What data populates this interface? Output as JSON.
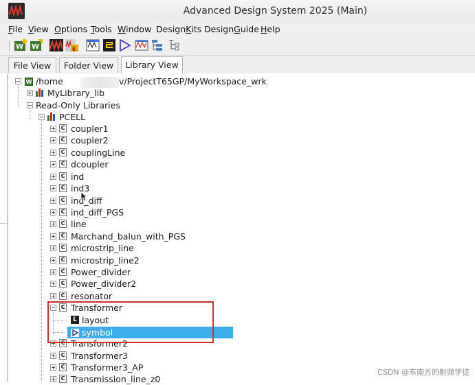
{
  "window": {
    "title": "Advanced Design System 2025 (Main)"
  },
  "menu": {
    "items": [
      {
        "label": "File",
        "mnemonic": "F",
        "rest": "ile"
      },
      {
        "label": "View",
        "mnemonic": "V",
        "rest": "iew"
      },
      {
        "label": "Options",
        "mnemonic": "O",
        "rest": "ptions"
      },
      {
        "label": "Tools",
        "mnemonic": "T",
        "rest": "ools"
      },
      {
        "label": "Window",
        "mnemonic": "W",
        "rest": "indow"
      },
      {
        "label": "DesignKits",
        "pre": "Design",
        "mnemonic": "K",
        "rest": "its"
      },
      {
        "label": "DesignGuide",
        "pre": "Design",
        "mnemonic": "G",
        "rest": "uide"
      },
      {
        "label": "Help",
        "mnemonic": "H",
        "rest": "elp"
      }
    ]
  },
  "toolbar": {
    "icons": [
      "new-workspace-icon",
      "open-workspace-icon",
      "ads-main-icon",
      "ads-extension-icon",
      "data-display-icon",
      "layout-icon",
      "schematic-symbol-icon",
      "simulation-icon",
      "hierarchy-icon",
      "tree-icon"
    ]
  },
  "tabs": [
    {
      "label": "File View",
      "active": false
    },
    {
      "label": "Folder View",
      "active": false
    },
    {
      "label": "Library View",
      "active": true
    }
  ],
  "tree": {
    "workspace_path_prefix": "/home",
    "workspace_path_suffix": "v/ProjectT65GP/MyWorkspace_wrk",
    "my_library": "MyLibrary_lib",
    "read_only_group": "Read-Only Libraries",
    "pcell_library": "PCELL",
    "cells": [
      "coupler1",
      "coupler2",
      "couplingLine",
      "dcoupler",
      "ind",
      "ind3",
      "ind_diff",
      "ind_diff_PGS",
      "line",
      "Marchand_balun_with_PGS",
      "microstrip_line",
      "microstrip_line2",
      "Power_divider",
      "Power_divider2",
      "resonator"
    ],
    "expanded_cell": "Transformer",
    "views": [
      {
        "label": "layout",
        "icon": "layout-view-icon"
      },
      {
        "label": "symbol",
        "icon": "symbol-view-icon",
        "selected": true
      }
    ],
    "cells_after": [
      "Transformer2",
      "Transformer3",
      "Transformer3_AP",
      "Transmission_line_z0"
    ]
  },
  "colors": {
    "selection": "#3daee9",
    "highlight_box": "#d32f2f"
  },
  "watermark": "CSDN @东南方的射频学徒"
}
